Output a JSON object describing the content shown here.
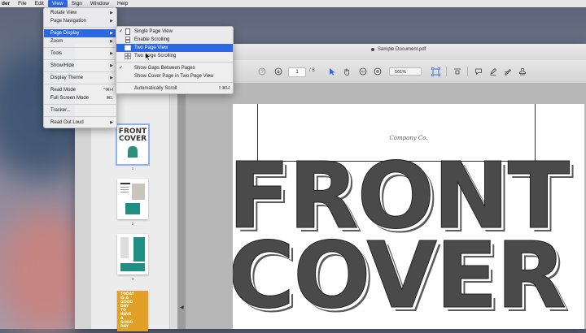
{
  "menubar": {
    "items": [
      "der",
      "File",
      "Edit",
      "View",
      "Sign",
      "Window",
      "Help"
    ],
    "active": "View"
  },
  "view_menu": {
    "items": [
      {
        "label": "Rotate View",
        "submenu": true
      },
      {
        "label": "Page Navigation",
        "submenu": true
      },
      {
        "label": "Page Display",
        "submenu": true,
        "highlighted": true
      },
      {
        "label": "Zoom",
        "submenu": true
      },
      {
        "label": "Tools",
        "submenu": true
      },
      {
        "label": "Show/Hide",
        "submenu": true
      },
      {
        "label": "Display Theme",
        "submenu": true
      },
      {
        "label": "Read Mode",
        "shortcut": "^⌘H"
      },
      {
        "label": "Full Screen Mode",
        "shortcut": "⌘L"
      },
      {
        "label": "Tracker..."
      },
      {
        "label": "Read Out Loud",
        "submenu": true
      }
    ]
  },
  "page_display_menu": {
    "items": [
      {
        "label": "Single Page View",
        "checked": true,
        "icon": "single-page-icon"
      },
      {
        "label": "Enable Scrolling",
        "icon": "scrolling-icon"
      },
      {
        "label": "Two Page View",
        "highlighted": true,
        "icon": "two-page-icon"
      },
      {
        "label": "Two Page Scrolling",
        "icon": "two-page-scrolling-icon"
      },
      {
        "label": "Show Gaps Between Pages",
        "checked": true
      },
      {
        "label": "Show Cover Page in Two Page View"
      },
      {
        "label": "Automatically Scroll",
        "shortcut": "⇧⌘H"
      }
    ]
  },
  "window": {
    "title": "Sample Document.pdf",
    "toolbar": {
      "page_current": "1",
      "page_total": "/ 8",
      "zoom": "101%"
    }
  },
  "thumbnails": [
    {
      "num": "1",
      "lines": [
        "FRONT",
        "COVER"
      ]
    },
    {
      "num": "2"
    },
    {
      "num": "3"
    },
    {
      "num": "",
      "lines": [
        "TODAY",
        "IS A",
        "GOOD",
        "DAY",
        "TO",
        "HAVE",
        "A",
        "GOOD",
        "DAY"
      ]
    }
  ],
  "document": {
    "company": "Company Co.",
    "headline_1": "FRONT",
    "headline_2": "COVER"
  },
  "colors": {
    "menu_highlight": "#2d68e3",
    "teal": "#1f8f83",
    "gold": "#e0a126"
  }
}
